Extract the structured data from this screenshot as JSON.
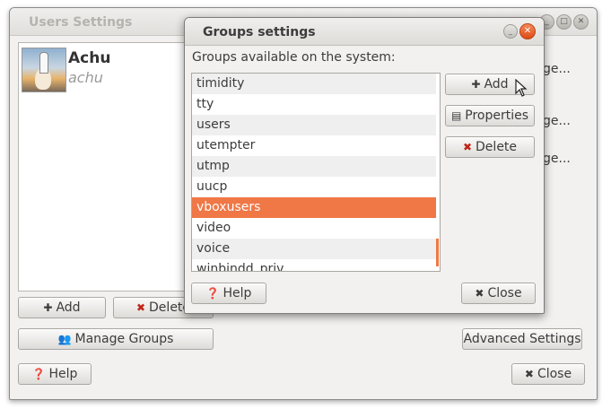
{
  "users_window": {
    "title": "Users Settings",
    "user": {
      "name": "Achu",
      "login": "achu"
    },
    "side_labels": [
      "ge...",
      "ge...",
      "ge..."
    ],
    "buttons": {
      "add": "Add",
      "delete": "Delete",
      "manage_groups": "Manage Groups",
      "advanced_settings": "Advanced Settings",
      "help": "Help",
      "close": "Close"
    }
  },
  "groups_dialog": {
    "title": "Groups settings",
    "label": "Groups available on the system:",
    "groups": [
      "timidity",
      "tty",
      "users",
      "utempter",
      "utmp",
      "uucp",
      "vboxusers",
      "video",
      "voice",
      "winbindd_priv"
    ],
    "selected_group": "vboxusers",
    "buttons": {
      "add": "Add",
      "properties": "Properties",
      "delete": "Delete",
      "help": "Help",
      "close": "Close"
    }
  },
  "colors": {
    "selection": "#f07746",
    "close_button": "#de4a17",
    "window_bg": "#f2f1f0"
  },
  "icons": {
    "add": "plus-icon",
    "delete": "x-icon",
    "properties": "properties-icon",
    "help": "help-bubble-icon",
    "close": "x-icon",
    "manage_groups": "group-icon"
  }
}
